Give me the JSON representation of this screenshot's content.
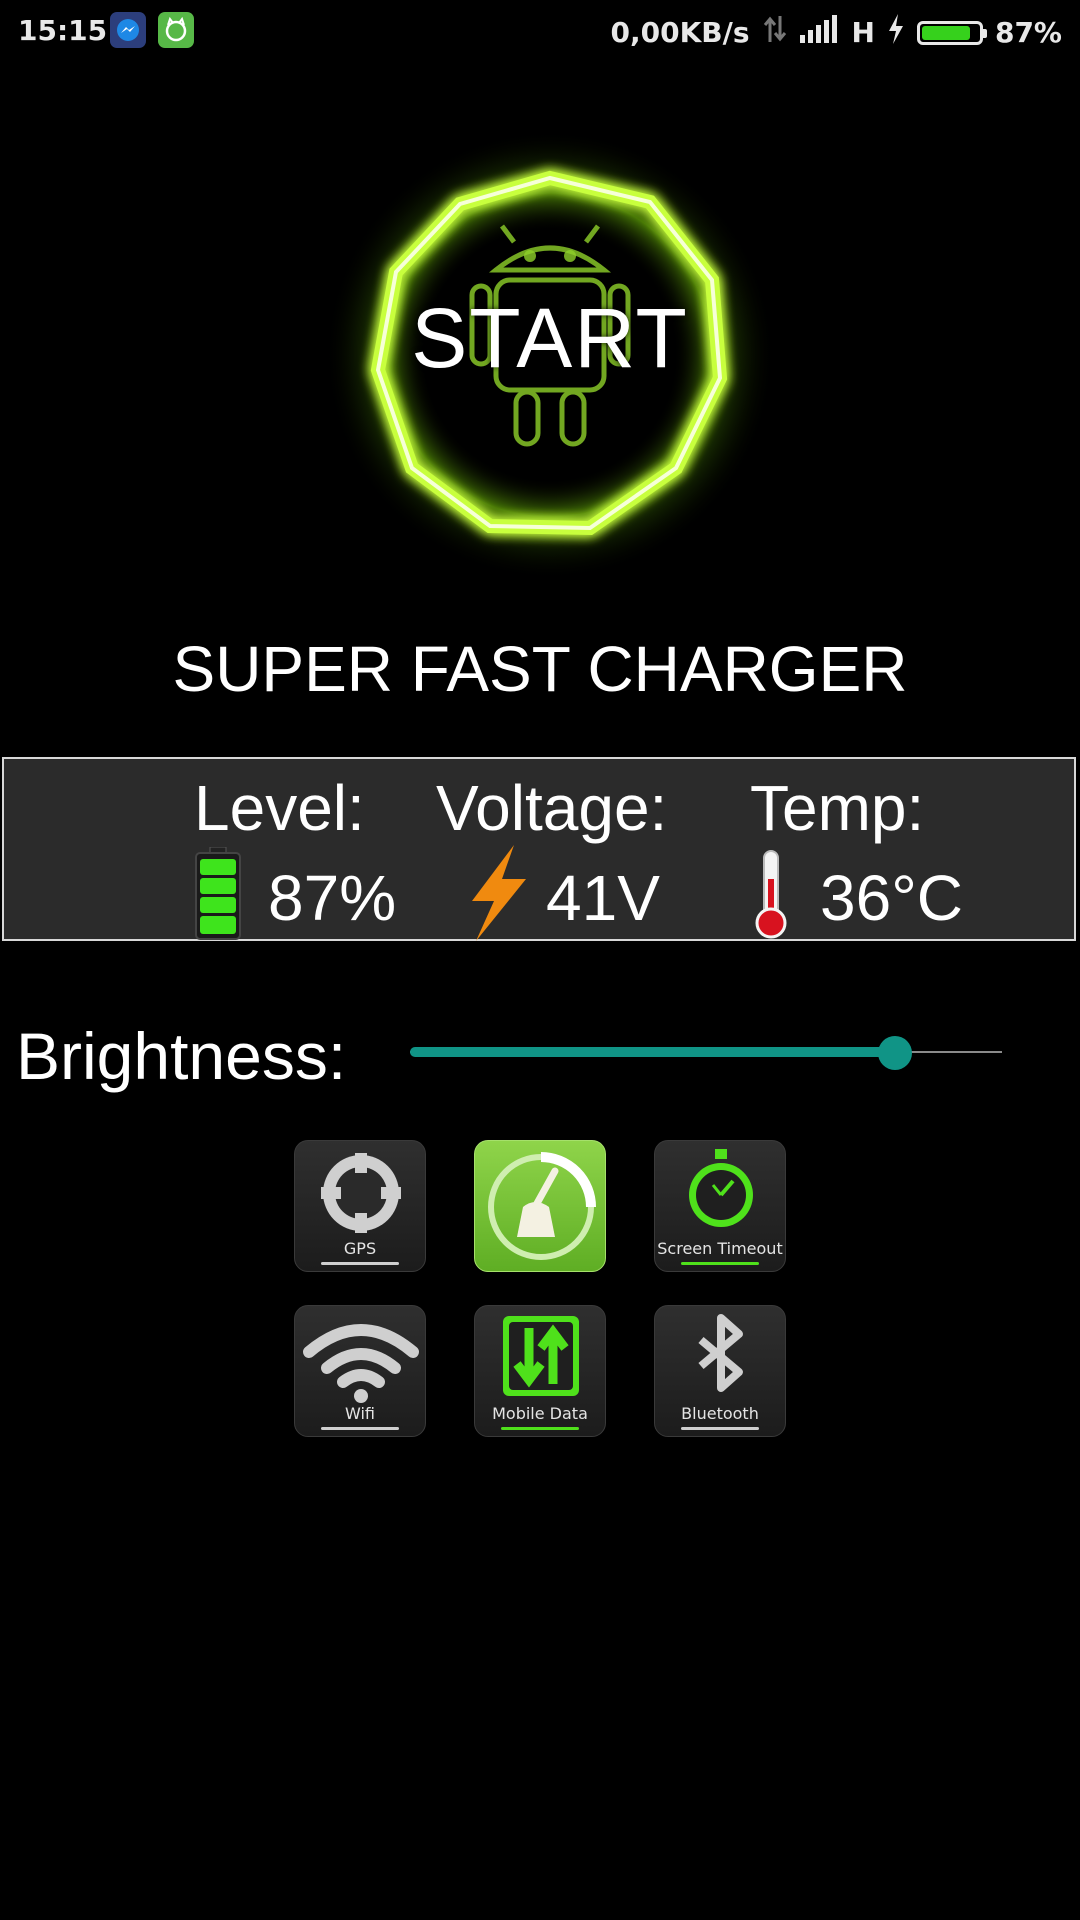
{
  "status_bar": {
    "time": "15:15",
    "network_speed": "0,00KB/s",
    "network_type": "H",
    "battery_percent": "87%",
    "battery_fill_fraction": 0.87
  },
  "start_button": {
    "label": "START"
  },
  "app_title": "SUPER FAST CHARGER",
  "stats": {
    "level": {
      "label": "Level:",
      "value": "87%"
    },
    "voltage": {
      "label": "Voltage:",
      "value": "41V"
    },
    "temp": {
      "label": "Temp:",
      "value": "36°C"
    }
  },
  "brightness": {
    "label": "Brightness:",
    "level_fraction": 0.82
  },
  "toggles": [
    {
      "id": "gps",
      "caption": "GPS",
      "icon": "gps-icon",
      "active": false
    },
    {
      "id": "cleaner",
      "caption": "",
      "icon": "broom-icon",
      "active": true
    },
    {
      "id": "screen-timeout",
      "caption": "Screen Timeout",
      "icon": "stopwatch-icon",
      "active": true
    },
    {
      "id": "wifi",
      "caption": "Wifi",
      "icon": "wifi-icon",
      "active": false
    },
    {
      "id": "mobile-data",
      "caption": "Mobile Data",
      "icon": "mobile-data-icon",
      "active": true
    },
    {
      "id": "bluetooth",
      "caption": "Bluetooth",
      "icon": "bluetooth-icon",
      "active": false
    }
  ],
  "colors": {
    "background": "#000000",
    "accent_green": "#36d11c",
    "slider_teal": "#109486",
    "panel": "#2b2b2b"
  }
}
